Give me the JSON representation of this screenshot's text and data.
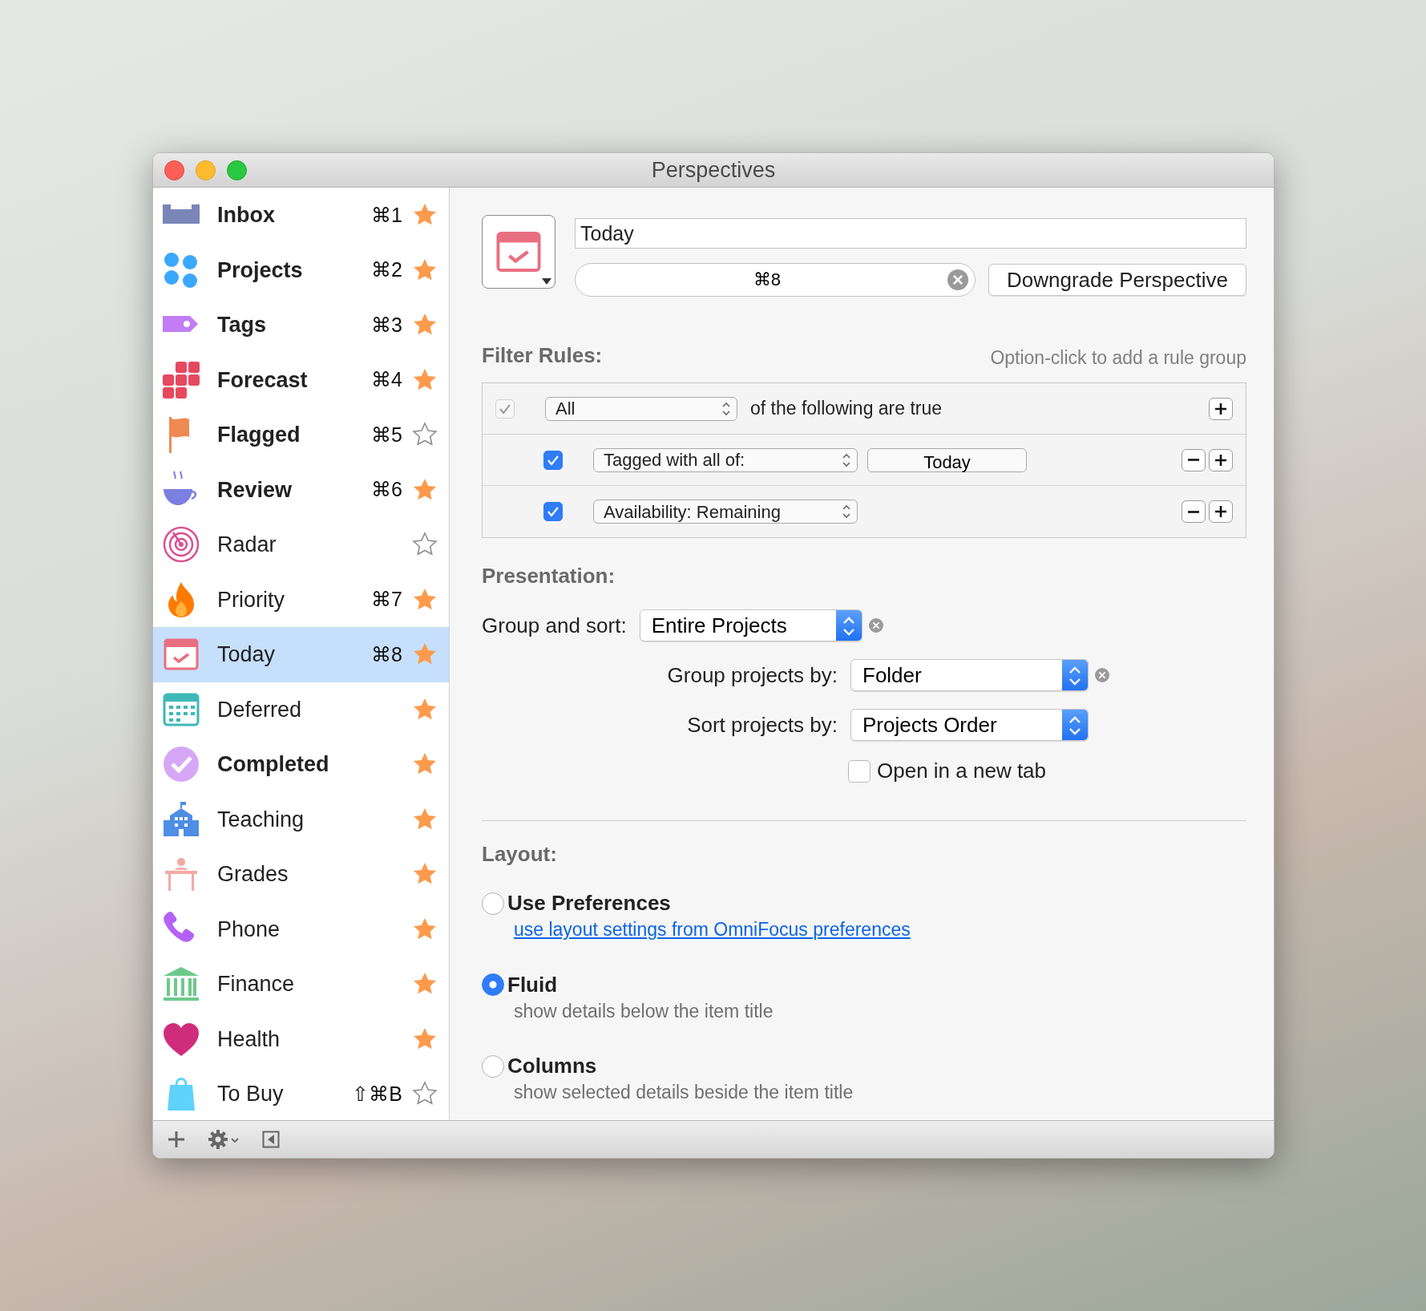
{
  "window": {
    "title": "Perspectives"
  },
  "sidebar": {
    "items": [
      {
        "kind": "inbox",
        "name": "Inbox",
        "shortcut": "⌘1",
        "bold": true,
        "starred": true,
        "selected": false
      },
      {
        "kind": "projects",
        "name": "Projects",
        "shortcut": "⌘2",
        "bold": true,
        "starred": true,
        "selected": false
      },
      {
        "kind": "tags",
        "name": "Tags",
        "shortcut": "⌘3",
        "bold": true,
        "starred": true,
        "selected": false
      },
      {
        "kind": "forecast",
        "name": "Forecast",
        "shortcut": "⌘4",
        "bold": true,
        "starred": true,
        "selected": false
      },
      {
        "kind": "flagged",
        "name": "Flagged",
        "shortcut": "⌘5",
        "bold": true,
        "starred": false,
        "selected": false
      },
      {
        "kind": "review",
        "name": "Review",
        "shortcut": "⌘6",
        "bold": true,
        "starred": true,
        "selected": false
      },
      {
        "kind": "radar",
        "name": "Radar",
        "bold": false,
        "starred": false,
        "selected": false
      },
      {
        "kind": "flame",
        "name": "Priority",
        "shortcut": "⌘7",
        "bold": false,
        "starred": true,
        "selected": false
      },
      {
        "kind": "today",
        "name": "Today",
        "shortcut": "⌘8",
        "bold": false,
        "starred": true,
        "selected": true
      },
      {
        "kind": "deferred",
        "name": "Deferred",
        "bold": false,
        "starred": true,
        "selected": false
      },
      {
        "kind": "completed",
        "name": "Completed",
        "bold": true,
        "starred": true,
        "selected": false
      },
      {
        "kind": "school",
        "name": "Teaching",
        "bold": false,
        "starred": true,
        "selected": false
      },
      {
        "kind": "desk",
        "name": "Grades",
        "bold": false,
        "starred": true,
        "selected": false
      },
      {
        "kind": "phone",
        "name": "Phone",
        "bold": false,
        "starred": true,
        "selected": false
      },
      {
        "kind": "bank",
        "name": "Finance",
        "bold": false,
        "starred": true,
        "selected": false
      },
      {
        "kind": "heart",
        "name": "Health",
        "bold": false,
        "starred": true,
        "selected": false
      },
      {
        "kind": "bag",
        "name": "To Buy",
        "shortcut": "⇧⌘B",
        "bold": false,
        "starred": false,
        "selected": false
      }
    ]
  },
  "editor": {
    "name_value": "Today",
    "shortcut_value": "⌘8",
    "downgrade_button": "Downgrade Perspective"
  },
  "filter_rules": {
    "heading": "Filter Rules:",
    "hint": "Option-click to add a rule group",
    "rules": [
      {
        "kind": "group",
        "checked": true,
        "disabled": true,
        "popup": "All",
        "text": "of the following are true"
      },
      {
        "kind": "condition",
        "checked": true,
        "disabled": false,
        "popup": "Tagged with all of:",
        "token": "Today"
      },
      {
        "kind": "condition",
        "checked": true,
        "disabled": false,
        "popup": "Availability: Remaining"
      }
    ]
  },
  "presentation": {
    "heading": "Presentation:",
    "fields": [
      {
        "kind": "primary",
        "label": "Group and sort:",
        "value": "Entire Projects",
        "clearable": true
      },
      {
        "kind": "secondary",
        "label": "Group projects by:",
        "value": "Folder",
        "clearable": true
      },
      {
        "kind": "secondary",
        "label": "Sort projects by:",
        "value": "Projects Order",
        "clearable": false
      }
    ],
    "option": {
      "label": "Open in a new tab",
      "checked": false
    }
  },
  "layout": {
    "heading": "Layout:",
    "options": [
      {
        "title": "Use Preferences",
        "description": "use layout settings from OmniFocus preferences",
        "link": true,
        "selected": false
      },
      {
        "title": "Fluid",
        "description": "show details below the item title",
        "link": false,
        "selected": true
      },
      {
        "title": "Columns",
        "description": "show selected details beside the item title",
        "link": false,
        "selected": false
      }
    ]
  }
}
